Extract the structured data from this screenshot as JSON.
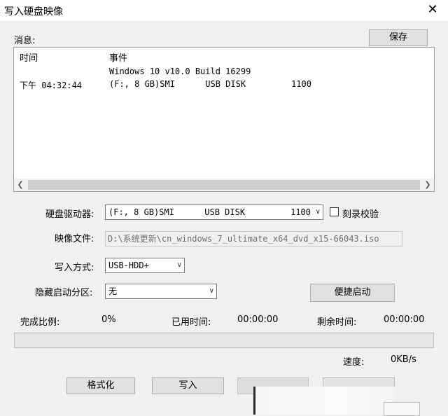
{
  "window": {
    "title": "写入硬盘映像",
    "close_glyph": "✕"
  },
  "messages": {
    "label": "消息:",
    "save_button": "保存",
    "columns": [
      "时间",
      "事件"
    ],
    "rows": [
      {
        "time": "",
        "event": "Windows 10 v10.0 Build 16299"
      },
      {
        "time": "下午 04:32:44",
        "event": "(F:, 8 GB)SMI      USB DISK         1100"
      }
    ]
  },
  "form": {
    "drive_label": "硬盘驱动器:",
    "drive_value": "(F:, 8 GB)SMI      USB DISK         1100",
    "verify_label": "刻录校验",
    "verify_checked": false,
    "image_label": "映像文件:",
    "image_path": "D:\\系统更新\\cn_windows_7_ultimate_x64_dvd_x15-66043.iso",
    "write_mode_label": "写入方式:",
    "write_mode_value": "USB-HDD+",
    "hide_partition_label": "隐藏启动分区:",
    "hide_partition_value": "无",
    "quick_boot_button": "便捷启动"
  },
  "status": {
    "progress_label": "完成比例:",
    "progress_value": "0%",
    "progress_fraction": 0,
    "elapsed_label": "已用时间:",
    "elapsed_value": "00:00:00",
    "remaining_label": "剩余时间:",
    "remaining_value": "00:00:00",
    "speed_label": "速度:",
    "speed_value": "0KB/s"
  },
  "buttons": {
    "format": "格式化",
    "write": "写入"
  }
}
